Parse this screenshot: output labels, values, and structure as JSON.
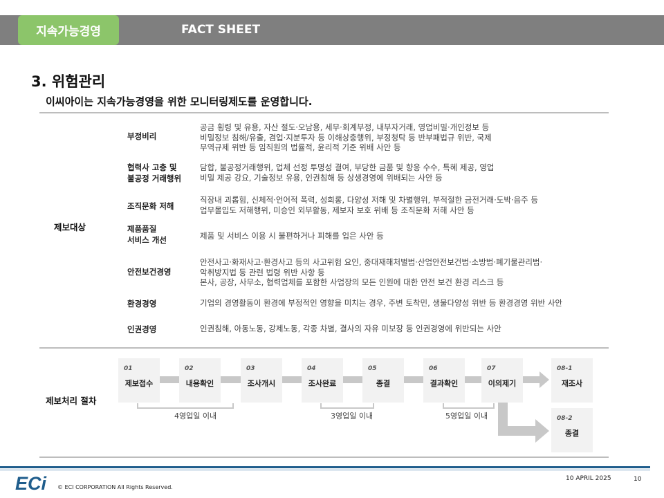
{
  "header": {
    "section": "지속가능경영",
    "title": "FACT SHEET"
  },
  "page": {
    "title": "3. 위험관리",
    "subtitle": "이씨아이는 지속가능경영을 위한 모니터링제도를 운영합니다."
  },
  "report_targets": {
    "label": "제보대상",
    "items": [
      {
        "category": [
          "부정비리"
        ],
        "lines": [
          "공금 횡령 및 유용, 자산 절도·오남용, 세무·회계부정, 내부자거래, 영업비밀·개인정보 등",
          "비밀정보 침해/유출, 겸업·지분투자 등 이해상충행위, 부정청탁 등 반부패법규 위반, 국제",
          "무역규제 위반 등 임직원의 법률적, 윤리적 기준 위배 사안 등"
        ]
      },
      {
        "category": [
          "협력사 고충 및",
          "불공정 거래행위"
        ],
        "lines": [
          "담합, 불공정거래행위, 업체 선정 투명성 결여, 부당한 금품 및 향응 수수, 특혜 제공, 영업",
          "비밀 제공 강요, 기술정보 유용, 인권침해 등 상생경영에 위배되는 사안 등"
        ]
      },
      {
        "category": [
          "조직문화 저해"
        ],
        "lines": [
          "직장내 괴롭힘, 신체적·언어적 폭력, 성희롱, 다양성 저해 및 차별행위, 부적절한 금전거래·도박·음주 등",
          "업무몰입도 저해행위, 미승인 외부활동, 제보자 보호 위배 등 조직문화 저해 사안 등"
        ]
      },
      {
        "category": [
          "제품품질",
          "서비스 개선"
        ],
        "lines": [
          "제품 및 서비스 이용 시 불편하거나 피해를 입은 사안 등"
        ]
      },
      {
        "category": [
          "안전보건경영"
        ],
        "lines": [
          "안전사고·화재사고·환경사고 등의 사고위험 요인, 중대재해처벌법·산업안전보건법·소방법·폐기물관리법·",
          "악취방지법 등 관련 법령 위반 사항 등",
          "본사, 공장, 사무소, 협력업체를 포함한 사업장의 모든 인원에 대한 안전 보건 환경 리스크 등"
        ]
      },
      {
        "category": [
          "환경경영"
        ],
        "lines": [
          "기업의 경영활동이 환경에 부정적인 영향을 미치는 경우, 주변 토착민, 생물다양성 위반 등 환경경영 위반 사안"
        ]
      },
      {
        "category": [
          "인권경영"
        ],
        "lines": [
          "인권침해, 아동노동, 강제노동, 각종 차별, 결사의 자유 미보장 등 인권경영에 위반되는 사안"
        ]
      }
    ]
  },
  "process": {
    "label": "제보처리 절차",
    "steps": [
      {
        "num": "01",
        "label": "제보접수"
      },
      {
        "num": "02",
        "label": "내용확인"
      },
      {
        "num": "03",
        "label": "조사개시"
      },
      {
        "num": "04",
        "label": "조사완료"
      },
      {
        "num": "05",
        "label": "종결"
      },
      {
        "num": "06",
        "label": "결과확인"
      },
      {
        "num": "07",
        "label": "이의제기"
      },
      {
        "num": "08-1",
        "label": "재조사"
      },
      {
        "num": "08-2",
        "label": "종결"
      }
    ],
    "periods": [
      "4영업일 이내",
      "3영업일 이내",
      "5영업일 이내"
    ]
  },
  "footer": {
    "logo_text": "ECi",
    "copyright": "© ECI CORPORATION All Rights Reserved.",
    "date": "10 APRIL 2025",
    "page_number": "10"
  },
  "colors": {
    "band": "#7f7f7f",
    "tag": "#8cc56a",
    "step": "#f2f2f2",
    "connector": "#c8c8c8",
    "footer_rule": "#1f5d8c",
    "logo": "#1f5d8c"
  }
}
